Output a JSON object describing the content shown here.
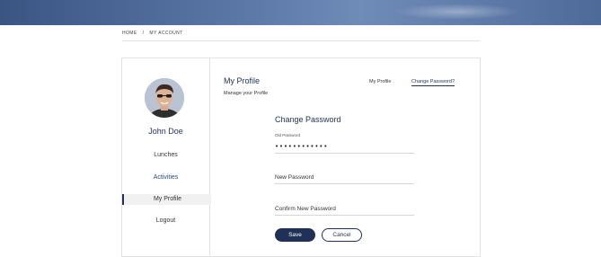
{
  "breadcrumb": {
    "home": "HOME",
    "separator": "/",
    "current": "MY ACCOUNT"
  },
  "sidebar": {
    "user_name": "John Doe",
    "items": [
      {
        "label": "Lunches",
        "active": false
      },
      {
        "label": "Activities",
        "active": false
      },
      {
        "label": "My Profile",
        "active": true
      },
      {
        "label": "Logout",
        "active": false
      }
    ]
  },
  "profile": {
    "title": "My Profile",
    "subtitle": "Manage your Profile"
  },
  "tabs": [
    {
      "label": "My Profile",
      "active": false
    },
    {
      "label": "Change Password?",
      "active": true
    }
  ],
  "form": {
    "title": "Change Password",
    "old_password_label": "Old Password",
    "old_password_value": "••••••••••••",
    "new_password_placeholder": "New Password",
    "confirm_password_placeholder": "Confirm New Password",
    "save_label": "Save",
    "cancel_label": "Cancel"
  },
  "colors": {
    "brand": "#1f3157",
    "accent_link": "#2b4a86",
    "hero": "#4e6a99"
  },
  "icons": {
    "avatar": "user-photo"
  }
}
